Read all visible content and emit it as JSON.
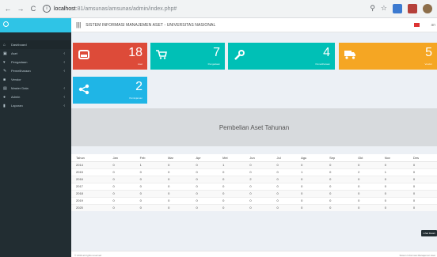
{
  "browser": {
    "url_host": "localhost",
    "url_path": ":81/amsunas/amsunas/admin/index.php#"
  },
  "header": {
    "title": "SISTEM INFORMASI MANAJEMEN ASET - UNIVERSITAS NASIONAL",
    "user_label": "an"
  },
  "sidebar": {
    "items": [
      {
        "label": "Dashboard",
        "icon": "home-icon"
      },
      {
        "label": "Aset",
        "icon": "box-icon"
      },
      {
        "label": "Pengadaan",
        "icon": "cart-icon"
      },
      {
        "label": "Pemeliharaan",
        "icon": "wrench-icon"
      },
      {
        "label": "Vendor",
        "icon": "truck-icon"
      },
      {
        "label": "Master Data",
        "icon": "database-icon"
      },
      {
        "label": "Admin",
        "icon": "user-icon"
      },
      {
        "label": "Laporan",
        "icon": "file-icon"
      }
    ]
  },
  "tiles": [
    {
      "value": "18",
      "label": "Aset",
      "icon": "inbox-icon",
      "color": "#dd4b39"
    },
    {
      "value": "7",
      "label": "Pengadaan",
      "icon": "cart-icon",
      "color": "#00c0b6"
    },
    {
      "value": "4",
      "label": "Pemeliharaan",
      "icon": "wrench-icon",
      "color": "#00c0b6"
    },
    {
      "value": "5",
      "label": "Vendor",
      "icon": "truck-icon",
      "color": "#f5a623"
    },
    {
      "value": "2",
      "label": "Peminjaman",
      "icon": "share-icon",
      "color": "#1fb5e6"
    }
  ],
  "chart": {
    "title": "Pembelian Aset Tahunan"
  },
  "table": {
    "headers": [
      "Tahun",
      "Jan",
      "Feb",
      "Mar",
      "Apr",
      "Mei",
      "Jun",
      "Jul",
      "Agu",
      "Sep",
      "Okt",
      "Nov",
      "Des"
    ],
    "rows": [
      [
        "2014",
        "0",
        "1",
        "0",
        "0",
        "1",
        "0",
        "0",
        "0",
        "0",
        "0",
        "0",
        "0"
      ],
      [
        "2015",
        "0",
        "0",
        "0",
        "0",
        "0",
        "0",
        "0",
        "1",
        "0",
        "2",
        "1",
        "0"
      ],
      [
        "2016",
        "0",
        "0",
        "0",
        "0",
        "0",
        "2",
        "0",
        "0",
        "0",
        "0",
        "0",
        "0"
      ],
      [
        "2017",
        "0",
        "0",
        "0",
        "0",
        "0",
        "0",
        "0",
        "0",
        "0",
        "0",
        "0",
        "0"
      ],
      [
        "2018",
        "0",
        "0",
        "0",
        "0",
        "0",
        "0",
        "0",
        "0",
        "0",
        "0",
        "0",
        "0"
      ],
      [
        "2019",
        "0",
        "0",
        "0",
        "0",
        "0",
        "0",
        "0",
        "0",
        "0",
        "0",
        "0",
        "0"
      ],
      [
        "2020",
        "0",
        "0",
        "0",
        "0",
        "0",
        "0",
        "0",
        "0",
        "0",
        "0",
        "0",
        "0"
      ]
    ]
  },
  "detail_button": "Lihat Detail",
  "footer": {
    "left": "© 2019 all rights reserved",
    "right": "Sistem Informasi Manajemen Aset"
  }
}
